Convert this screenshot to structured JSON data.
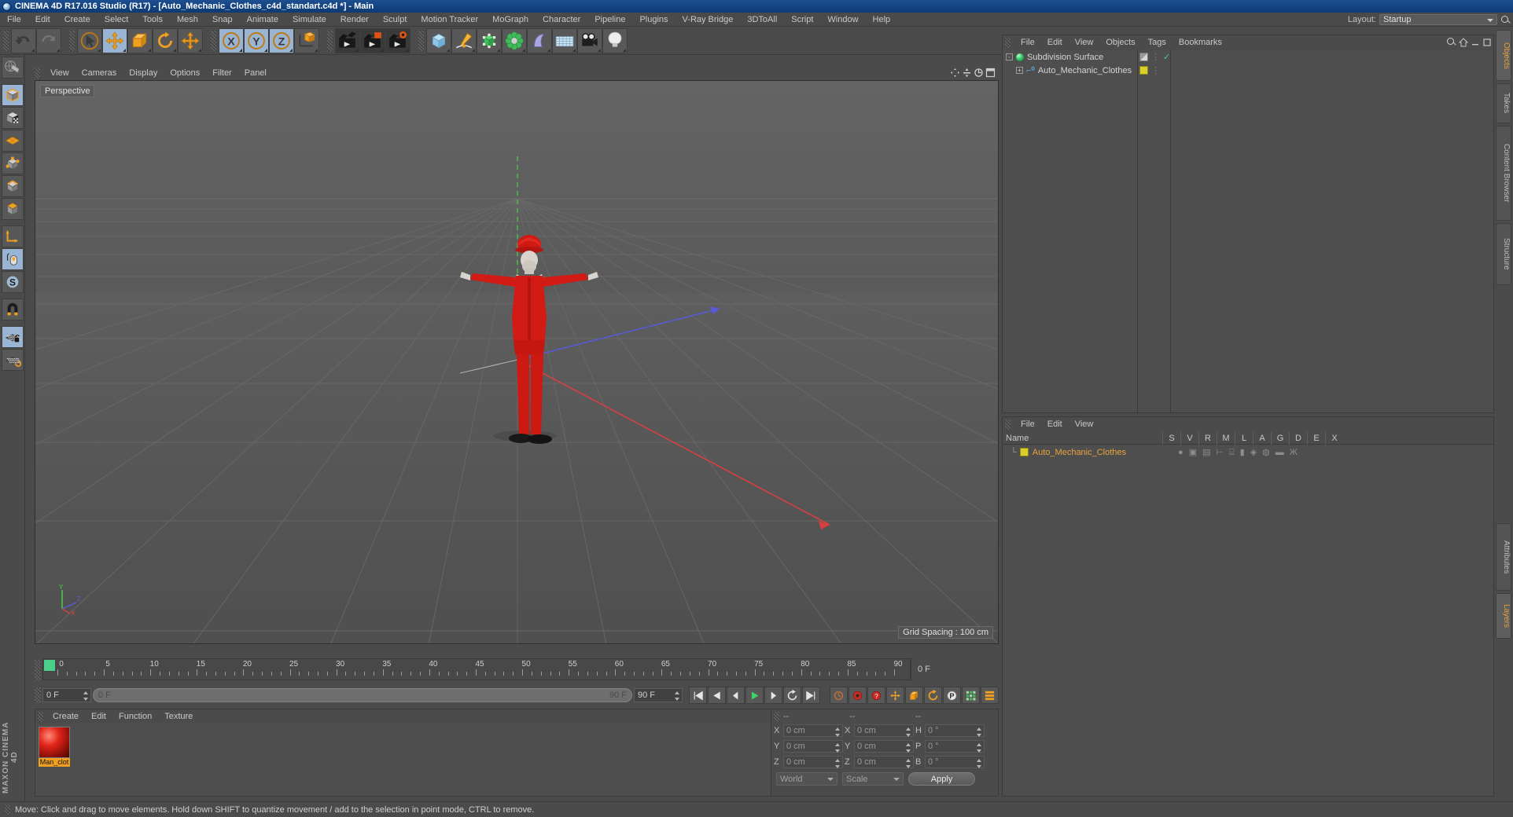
{
  "window": {
    "title": "CINEMA 4D R17.016 Studio (R17) - [Auto_Mechanic_Clothes_c4d_standart.c4d *] - Main",
    "logo_icon": "c4d-logo-icon"
  },
  "menubar": {
    "items": [
      "File",
      "Edit",
      "Create",
      "Select",
      "Tools",
      "Mesh",
      "Snap",
      "Animate",
      "Simulate",
      "Render",
      "Sculpt",
      "Motion Tracker",
      "MoGraph",
      "Character",
      "Pipeline",
      "Plugins",
      "V-Ray Bridge",
      "3DToAll",
      "Script",
      "Window",
      "Help"
    ],
    "layout_label": "Layout:",
    "layout_value": "Startup",
    "search_icon": "magnifier-icon"
  },
  "toolbar": {
    "groups": [
      {
        "name": "undo-redo",
        "buttons": [
          {
            "icon": "undo-icon",
            "label": "Undo",
            "state": "normal"
          },
          {
            "icon": "redo-icon",
            "label": "Redo",
            "state": "disabled"
          }
        ]
      },
      {
        "name": "transform-tools",
        "buttons": [
          {
            "icon": "select-arrow-icon",
            "label": "Live Selection",
            "state": "normal"
          },
          {
            "icon": "move-icon",
            "label": "Move",
            "state": "active"
          },
          {
            "icon": "scale-icon",
            "label": "Scale",
            "state": "normal"
          },
          {
            "icon": "rotate-icon",
            "label": "Rotate",
            "state": "normal"
          },
          {
            "icon": "move-alt-icon",
            "label": "Move (alt)",
            "state": "normal"
          }
        ]
      },
      {
        "name": "axis-locks",
        "buttons": [
          {
            "icon": "x-axis-icon",
            "label": "X",
            "state": "active"
          },
          {
            "icon": "y-axis-icon",
            "label": "Y",
            "state": "active"
          },
          {
            "icon": "z-axis-icon",
            "label": "Z",
            "state": "active"
          },
          {
            "icon": "world-object-axis-icon",
            "label": "World / Object",
            "state": "normal"
          }
        ]
      },
      {
        "name": "render-tools",
        "buttons": [
          {
            "icon": "render-view-icon",
            "label": "Render View",
            "state": "normal"
          },
          {
            "icon": "render-picture-viewer-icon",
            "label": "Render to Picture Viewer",
            "state": "normal"
          },
          {
            "icon": "render-settings-icon",
            "label": "Edit Render Settings",
            "state": "normal"
          }
        ]
      },
      {
        "name": "create-objects",
        "buttons": [
          {
            "icon": "cube-primitive-icon",
            "label": "Cube",
            "state": "normal"
          },
          {
            "icon": "spline-pen-icon",
            "label": "Spline Pen",
            "state": "normal"
          },
          {
            "icon": "generator-icon",
            "label": "Subdivision Surface",
            "state": "normal"
          },
          {
            "icon": "deformer-icon",
            "label": "Bend Deformer",
            "state": "normal"
          },
          {
            "icon": "scene-nurbs-icon",
            "label": "Scene Object",
            "state": "normal"
          },
          {
            "icon": "floor-environment-icon",
            "label": "Floor",
            "state": "normal"
          },
          {
            "icon": "camera-icon",
            "label": "Camera",
            "state": "normal"
          },
          {
            "icon": "light-icon",
            "label": "Light",
            "state": "normal"
          }
        ]
      }
    ]
  },
  "left_palette": {
    "buttons": [
      {
        "icon": "make-editable-icon",
        "label": "Make Editable",
        "state": "normal"
      },
      {
        "icon": "model-mode-icon",
        "label": "Model Mode",
        "state": "active"
      },
      {
        "icon": "texture-mode-icon",
        "label": "Texture Mode",
        "state": "normal"
      },
      {
        "icon": "polygon-mode-icon",
        "label": "Polygon Mode",
        "state": "normal"
      },
      {
        "icon": "point-mode-icon",
        "label": "Point Mode",
        "state": "normal"
      },
      {
        "icon": "edge-mode-icon",
        "label": "Edge Mode",
        "state": "normal"
      },
      {
        "icon": "object-axis-mode-icon",
        "label": "Object Axis",
        "state": "normal"
      },
      {
        "icon": "axis-lock-icon",
        "label": "Enable Axis Modification",
        "state": "normal"
      },
      {
        "icon": "viewport-solo-icon",
        "label": "Viewport Solo Single",
        "state": "active"
      },
      {
        "icon": "soft-selection-icon",
        "label": "Soft Selection",
        "state": "normal"
      },
      {
        "icon": "magnet-icon",
        "label": "Magnet",
        "state": "normal"
      },
      {
        "icon": "lock-workplane-icon",
        "label": "Lock Workplane",
        "state": "active"
      },
      {
        "icon": "workplane-icon",
        "label": "Planar Workplane",
        "state": "normal"
      }
    ],
    "brand_top": "MAXON",
    "brand_bottom": "CINEMA 4D"
  },
  "viewport": {
    "menu": [
      "View",
      "Cameras",
      "Display",
      "Options",
      "Filter",
      "Panel"
    ],
    "camera_label": "Perspective",
    "grid_spacing": "Grid Spacing : 100 cm",
    "axis_gizmo": {
      "y": "Y",
      "z": "Z",
      "x": "X"
    },
    "nav_icons": [
      "move-camera-icon",
      "pan-camera-icon",
      "zoom-camera-icon",
      "maximize-viewport-icon"
    ]
  },
  "timeline": {
    "ticks": [
      0,
      5,
      10,
      15,
      20,
      25,
      30,
      35,
      40,
      45,
      50,
      55,
      60,
      65,
      70,
      75,
      80,
      85,
      90
    ],
    "current_frame": "0 F",
    "start_field": "0 F",
    "range_start": "0 F",
    "range_end": "90 F",
    "end_field": "90 F",
    "playback_buttons": [
      {
        "icon": "go-to-start-icon",
        "label": "Go To Start"
      },
      {
        "icon": "play-reverse-icon",
        "label": "Play Reverse"
      },
      {
        "icon": "step-back-icon",
        "label": "Previous Frame"
      },
      {
        "icon": "play-icon",
        "label": "Play Forward"
      },
      {
        "icon": "step-forward-icon",
        "label": "Next Frame"
      },
      {
        "icon": "loop-icon",
        "label": "Loop"
      },
      {
        "icon": "go-to-end-icon",
        "label": "Go To End"
      }
    ],
    "keyframe_buttons": [
      {
        "icon": "autokey-icon",
        "label": "Autokeying"
      },
      {
        "icon": "record-active-icon",
        "label": "Record Active Objects"
      },
      {
        "icon": "keyframe-selection-icon",
        "label": "Keyframe Selection"
      },
      {
        "icon": "position-key-icon",
        "label": "Position"
      },
      {
        "icon": "scale-key-icon",
        "label": "Scale"
      },
      {
        "icon": "rotation-key-icon",
        "label": "Rotation"
      },
      {
        "icon": "param-key-icon",
        "label": "Parameter"
      },
      {
        "icon": "pla-key-icon",
        "label": "Point Level Animation"
      },
      {
        "icon": "timeline-menu-icon",
        "label": "Timeline Options"
      }
    ]
  },
  "material_manager": {
    "menu": [
      "Create",
      "Edit",
      "Function",
      "Texture"
    ],
    "materials": [
      {
        "name": "Man_clot",
        "swatch_icon": "material-sphere-icon",
        "selected": true
      }
    ]
  },
  "coordinates": {
    "headers": [
      "--",
      "--",
      "--"
    ],
    "rows": [
      {
        "pos_label": "X",
        "pos_value": "0 cm",
        "size_label": "X",
        "size_value": "0 cm",
        "rot_label": "H",
        "rot_value": "0 °"
      },
      {
        "pos_label": "Y",
        "pos_value": "0 cm",
        "size_label": "Y",
        "size_value": "0 cm",
        "rot_label": "P",
        "rot_value": "0 °"
      },
      {
        "pos_label": "Z",
        "pos_value": "0 cm",
        "size_label": "Z",
        "size_value": "0 cm",
        "rot_label": "B",
        "rot_value": "0 °"
      }
    ],
    "coord_system": "World",
    "mode": "Scale",
    "apply_label": "Apply"
  },
  "object_manager": {
    "menu": [
      "File",
      "Edit",
      "View",
      "Objects",
      "Tags",
      "Bookmarks"
    ],
    "header_icons": [
      "magnifier-icon",
      "home-icon",
      "minimize-icon",
      "maximize-icon"
    ],
    "tree": [
      {
        "label": "Subdivision Surface",
        "icon": "subdivision-surface-icon",
        "depth": 0,
        "expander": "-",
        "visibility_dot": "visible-check-icon",
        "tag": "display-tag-icon"
      },
      {
        "label": "Auto_Mechanic_Clothes",
        "icon": "polygon-object-icon",
        "depth": 1,
        "expander": "+",
        "tag": "material-tag-icon"
      }
    ]
  },
  "layer_manager": {
    "menu": [
      "File",
      "Edit",
      "View"
    ],
    "columns": [
      "Name",
      "S",
      "V",
      "R",
      "M",
      "L",
      "A",
      "G",
      "D",
      "E",
      "X"
    ],
    "rows": [
      {
        "name": "Auto_Mechanic_Clothes",
        "color_icon": "layer-color-swatch-icon"
      }
    ]
  },
  "side_tabs": {
    "top": [
      {
        "label": "Objects",
        "selected": true
      },
      {
        "label": "Takes",
        "selected": false
      },
      {
        "label": "Content Browser",
        "selected": false
      },
      {
        "label": "Structure",
        "selected": false
      }
    ],
    "bottom": [
      {
        "label": "Attributes",
        "selected": false
      },
      {
        "label": "Layers",
        "selected": true
      }
    ]
  },
  "statusbar": {
    "message": "Move: Click and drag to move elements. Hold down SHIFT to quantize movement / add to the selection in point mode, CTRL to remove."
  }
}
